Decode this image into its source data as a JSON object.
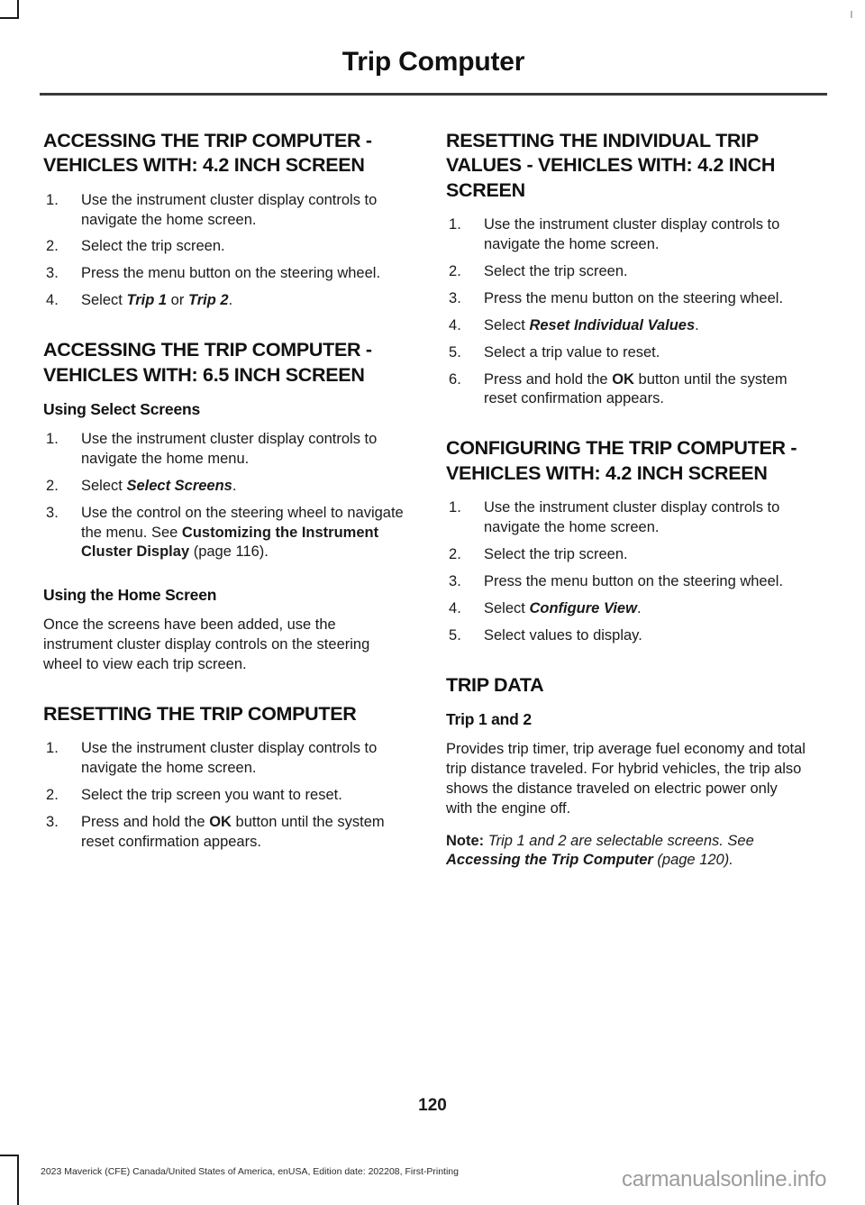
{
  "header": {
    "title": "Trip Computer"
  },
  "left_column": {
    "section1": {
      "heading": "ACCESSING THE TRIP COMPUTER - VEHICLES WITH: 4.2 INCH SCREEN",
      "steps": [
        {
          "prefix": "Use the instrument cluster display controls to navigate the home screen.",
          "emphasis": "",
          "suffix": ""
        },
        {
          "prefix": "Select the trip screen.",
          "emphasis": "",
          "suffix": ""
        },
        {
          "prefix": "Press the menu button on the steering wheel.",
          "emphasis": "",
          "suffix": ""
        },
        {
          "prefix": "Select ",
          "emphasis": "Trip 1",
          "mid": " or ",
          "emphasis2": "Trip 2",
          "suffix": "."
        }
      ]
    },
    "section2": {
      "heading": "ACCESSING THE TRIP COMPUTER - VEHICLES WITH: 6.5 INCH SCREEN",
      "sub1": {
        "heading": "Using Select Screens",
        "steps": [
          {
            "prefix": "Use the instrument cluster display controls to navigate the home menu.",
            "emphasis": "",
            "suffix": ""
          },
          {
            "prefix": "Select ",
            "emphasis": "Select Screens",
            "suffix": "."
          },
          {
            "prefix": "Use the control on the steering wheel to navigate the menu.  See ",
            "emphasis": "Customizing the Instrument Cluster Display",
            "suffix": " (page 116)."
          }
        ]
      },
      "sub2": {
        "heading": "Using the Home Screen",
        "paragraph": "Once the screens have been added, use the instrument cluster display controls on the steering wheel to view each trip screen."
      }
    },
    "section3": {
      "heading": "RESETTING THE TRIP COMPUTER",
      "steps": [
        {
          "prefix": "Use the instrument cluster display controls to navigate the home screen.",
          "emphasis": "",
          "suffix": ""
        },
        {
          "prefix": "Select the trip screen you want to reset.",
          "emphasis": "",
          "suffix": ""
        },
        {
          "prefix": "Press and hold the ",
          "emphasis": "OK",
          "suffix": " button until the system reset confirmation appears."
        }
      ]
    }
  },
  "right_column": {
    "section1": {
      "heading": "RESETTING THE INDIVIDUAL TRIP VALUES - VEHICLES WITH: 4.2 INCH SCREEN",
      "steps": [
        {
          "prefix": "Use the instrument cluster display controls to navigate the home screen.",
          "emphasis": "",
          "suffix": ""
        },
        {
          "prefix": "Select the trip screen.",
          "emphasis": "",
          "suffix": ""
        },
        {
          "prefix": "Press the menu button on the steering wheel.",
          "emphasis": "",
          "suffix": ""
        },
        {
          "prefix": "Select ",
          "emphasis": "Reset Individual Values",
          "suffix": "."
        },
        {
          "prefix": "Select a trip value to reset.",
          "emphasis": "",
          "suffix": ""
        },
        {
          "prefix": "Press and hold the ",
          "emphasis": "OK",
          "suffix": " button until the system reset confirmation appears."
        }
      ]
    },
    "section2": {
      "heading": "CONFIGURING THE TRIP COMPUTER - VEHICLES WITH: 4.2 INCH SCREEN",
      "steps": [
        {
          "prefix": "Use the instrument cluster display controls to navigate the home screen.",
          "emphasis": "",
          "suffix": ""
        },
        {
          "prefix": "Select the trip screen.",
          "emphasis": "",
          "suffix": ""
        },
        {
          "prefix": "Press the menu button on the steering wheel.",
          "emphasis": "",
          "suffix": ""
        },
        {
          "prefix": "Select ",
          "emphasis": "Configure View",
          "suffix": "."
        },
        {
          "prefix": "Select values to display.",
          "emphasis": "",
          "suffix": ""
        }
      ]
    },
    "section3": {
      "heading": "TRIP DATA",
      "sub1": {
        "heading": "Trip 1 and 2",
        "paragraph": "Provides trip timer, trip average fuel economy and total trip distance traveled. For hybrid vehicles, the trip also shows the distance traveled on electric power only with the engine off.",
        "note_label": "Note:",
        "note_text_before": " Trip 1 and 2 are selectable screens. See ",
        "note_emphasis": "Accessing the Trip Computer",
        "note_text_after": " (page 120)."
      }
    }
  },
  "footer": {
    "page_number": "120",
    "edition_line": "2023 Maverick (CFE) Canada/United States of America, enUSA, Edition date: 202208, First-Printing",
    "watermark": "carmanualsonline.info"
  }
}
